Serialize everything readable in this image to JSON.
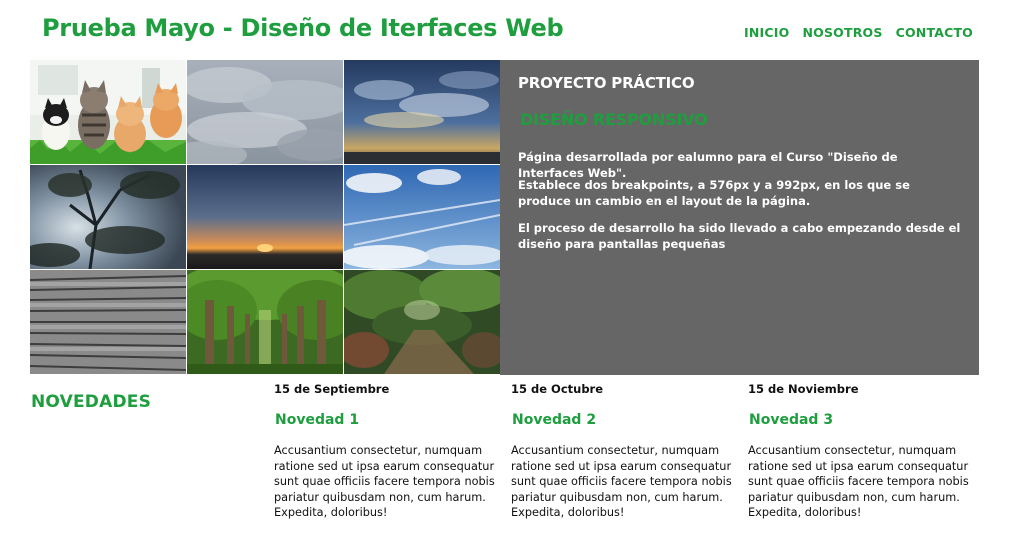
{
  "header": {
    "site_title": "Prueba Mayo - Diseño de Iterfaces Web",
    "nav": [
      "INICIO",
      "NOSOTROS",
      "CONTACTO"
    ]
  },
  "gallery": {
    "images": [
      "kittens-photo-icon",
      "cloudy-sky-photo-icon",
      "clouds-sunset-photo-icon",
      "tree-silhouette-photo-icon",
      "sunset-horizon-photo-icon",
      "blue-sky-contrails-photo-icon",
      "stone-steps-photo-icon",
      "tree-avenue-photo-icon",
      "jungle-path-photo-icon"
    ]
  },
  "panel": {
    "kicker": "PROYECTO PRÁCTICO",
    "title": "DISEÑO RESPONSIVO",
    "paragraphs": [
      "Página desarrollada por ealumno para el Curso \"Diseño de Interfaces Web\".",
      "Establece dos breakpoints, a 576px y a 992px, en los que se produce un cambio en el layout de la página.",
      "El proceso de desarrollo ha sido llevado a cabo empezando desde el diseño para pantallas pequeñas"
    ]
  },
  "news": {
    "heading": "NOVEDADES",
    "items": [
      {
        "date": "15 de Septiembre",
        "title": "Novedad 1",
        "body": "Accusantium consectetur, numquam ratione sed ut ipsa earum consequatur sunt quae officiis facere tempora nobis pariatur quibusdam non, cum harum. Expedita, doloribus!"
      },
      {
        "date": "15 de Octubre",
        "title": "Novedad 2",
        "body": "Accusantium consectetur, numquam ratione sed ut ipsa earum consequatur sunt quae officiis facere tempora nobis pariatur quibusdam non, cum harum. Expedita, doloribus!"
      },
      {
        "date": "15 de Noviembre",
        "title": "Novedad 3",
        "body": "Accusantium consectetur, numquam ratione sed ut ipsa earum consequatur sunt quae officiis facere tempora nobis pariatur quibusdam non, cum harum. Expedita, doloribus!"
      }
    ]
  },
  "colors": {
    "accent": "#1e9e3e",
    "panel_bg": "#666666",
    "text": "#111111"
  }
}
